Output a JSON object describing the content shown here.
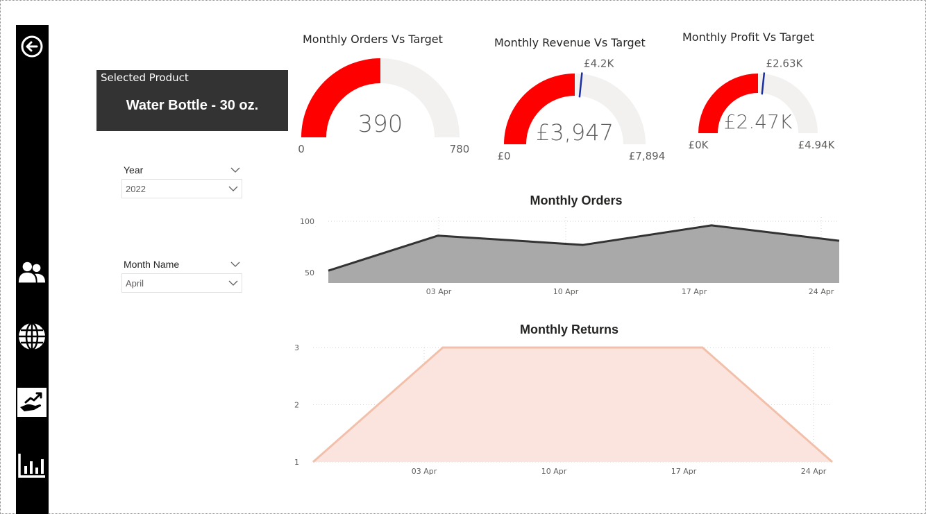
{
  "navigation": {
    "items": [
      {
        "name": "back",
        "icon": "back-arrow-icon"
      },
      {
        "name": "customers",
        "icon": "users-icon"
      },
      {
        "name": "geography",
        "icon": "globe-icon"
      },
      {
        "name": "products",
        "icon": "hand-growth-chart-icon",
        "active": true
      },
      {
        "name": "sales",
        "icon": "bar-chart-icon"
      }
    ]
  },
  "product_card": {
    "label": "Selected Product",
    "value": "Water Bottle - 30 oz."
  },
  "filters": {
    "year": {
      "label": "Year",
      "value": "2022"
    },
    "month": {
      "label": "Month Name",
      "value": "April"
    }
  },
  "colors": {
    "gauge_fill": "#ff0000",
    "gauge_track": "#f2f1f0",
    "target_line": "#1a2fa0",
    "area_orders": "#a9a9a9",
    "line_orders": "#333333",
    "area_returns": "#fbe4de",
    "line_returns": "#f2c0aa"
  },
  "gauges": [
    {
      "title": "Monthly Orders Vs Target",
      "value": 390,
      "value_label": "390",
      "min_label": "0",
      "max_label": "780",
      "min": 0,
      "max": 780
    },
    {
      "title": "Monthly Revenue Vs Target",
      "value": 3947,
      "value_label": "£3,947",
      "min_label": "£0",
      "max_label": "£7,894",
      "target": 4200,
      "target_label": "£4.2K",
      "min": 0,
      "max": 7894
    },
    {
      "title": "Monthly Profit Vs Target",
      "value": 2470,
      "value_label": "£2.47K",
      "min_label": "£0K",
      "max_label": "£4.94K",
      "target": 2630,
      "target_label": "£2.63K",
      "min": 0,
      "max": 4940
    }
  ],
  "chart_data": [
    {
      "type": "area",
      "title": "Monthly Orders",
      "xlabel": "",
      "ylabel": "",
      "x": [
        "2022-03-27",
        "2022-04-03",
        "2022-04-10",
        "2022-04-17",
        "2022-04-24"
      ],
      "xticks": [
        "03 Apr",
        "10 Apr",
        "17 Apr",
        "24 Apr"
      ],
      "yticks": [
        50,
        100
      ],
      "ylim": [
        40,
        104
      ],
      "series": [
        {
          "values": [
            52,
            86,
            77,
            96,
            81
          ]
        }
      ],
      "grid": true
    },
    {
      "type": "area",
      "title": "Monthly Returns",
      "xlabel": "",
      "ylabel": "",
      "x": [
        "2022-03-27",
        "2022-04-03",
        "2022-04-10",
        "2022-04-17",
        "2022-04-24"
      ],
      "xticks": [
        "03 Apr",
        "10 Apr",
        "17 Apr",
        "24 Apr"
      ],
      "yticks": [
        1,
        2,
        3
      ],
      "ylim": [
        1,
        3
      ],
      "series": [
        {
          "values": [
            1,
            3,
            3,
            3,
            1
          ]
        }
      ],
      "grid": true
    }
  ]
}
